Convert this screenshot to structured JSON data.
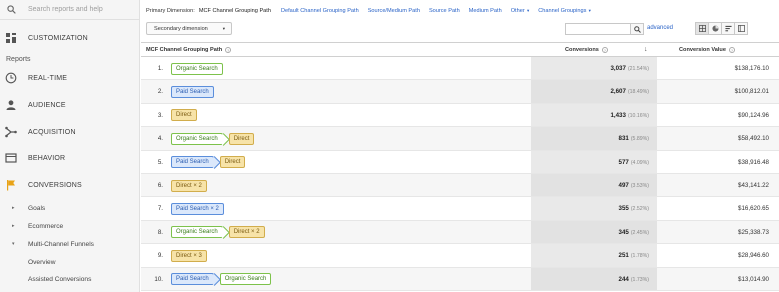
{
  "sidebar": {
    "search_placeholder": "Search reports and help",
    "customization": "CUSTOMIZATION",
    "reports_label": "Reports",
    "nav": [
      {
        "label": "REAL-TIME",
        "icon": "clock-icon"
      },
      {
        "label": "AUDIENCE",
        "icon": "person-icon"
      },
      {
        "label": "ACQUISITION",
        "icon": "acquisition-icon"
      },
      {
        "label": "BEHAVIOR",
        "icon": "behavior-icon"
      },
      {
        "label": "CONVERSIONS",
        "icon": "flag-icon"
      }
    ],
    "sub_items": [
      {
        "label": "Goals",
        "arrow": "▸"
      },
      {
        "label": "Ecommerce",
        "arrow": "▸"
      },
      {
        "label": "Multi-Channel Funnels",
        "arrow": "▾"
      },
      {
        "label": "Overview",
        "arrow": ""
      },
      {
        "label": "Assisted Conversions",
        "arrow": ""
      }
    ]
  },
  "dimensions": {
    "primary_label": "Primary Dimension:",
    "active": "MCF Channel Grouping Path",
    "links": [
      "Default Channel Grouping Path",
      "Source/Medium Path",
      "Source Path",
      "Medium Path"
    ],
    "other": "Other",
    "channel_groupings": "Channel Groupings"
  },
  "toolbar": {
    "secondary_dimension": "Secondary dimension",
    "advanced": "advanced"
  },
  "table": {
    "col_path": "MCF Channel Grouping Path",
    "col_conversions": "Conversions",
    "col_value": "Conversion Value",
    "rows": [
      {
        "num": "1.",
        "path": [
          {
            "label": "Organic Search",
            "type": "organic"
          }
        ],
        "conversions": "3,037",
        "pct": "(21.54%)",
        "value": "$138,176.10"
      },
      {
        "num": "2.",
        "path": [
          {
            "label": "Paid Search",
            "type": "paid"
          }
        ],
        "conversions": "2,607",
        "pct": "(18.49%)",
        "value": "$100,812.01"
      },
      {
        "num": "3.",
        "path": [
          {
            "label": "Direct",
            "type": "direct"
          }
        ],
        "conversions": "1,433",
        "pct": "(10.16%)",
        "value": "$90,124.96"
      },
      {
        "num": "4.",
        "path": [
          {
            "label": "Organic Search",
            "type": "organic"
          },
          {
            "label": "Direct",
            "type": "direct"
          }
        ],
        "conversions": "831",
        "pct": "(5.89%)",
        "value": "$58,492.10"
      },
      {
        "num": "5.",
        "path": [
          {
            "label": "Paid Search",
            "type": "paid"
          },
          {
            "label": "Direct",
            "type": "direct"
          }
        ],
        "conversions": "577",
        "pct": "(4.09%)",
        "value": "$38,916.48"
      },
      {
        "num": "6.",
        "path": [
          {
            "label": "Direct × 2",
            "type": "direct"
          }
        ],
        "conversions": "497",
        "pct": "(3.53%)",
        "value": "$43,141.22"
      },
      {
        "num": "7.",
        "path": [
          {
            "label": "Paid Search × 2",
            "type": "paid"
          }
        ],
        "conversions": "355",
        "pct": "(2.52%)",
        "value": "$16,620.65"
      },
      {
        "num": "8.",
        "path": [
          {
            "label": "Organic Search",
            "type": "organic"
          },
          {
            "label": "Direct × 2",
            "type": "direct"
          }
        ],
        "conversions": "345",
        "pct": "(2.45%)",
        "value": "$25,338.73"
      },
      {
        "num": "9.",
        "path": [
          {
            "label": "Direct × 3",
            "type": "direct"
          }
        ],
        "conversions": "251",
        "pct": "(1.78%)",
        "value": "$28,946.60"
      },
      {
        "num": "10.",
        "path": [
          {
            "label": "Paid Search",
            "type": "paid"
          },
          {
            "label": "Organic Search",
            "type": "organic"
          }
        ],
        "conversions": "244",
        "pct": "(1.73%)",
        "value": "$13,014.90"
      }
    ]
  }
}
